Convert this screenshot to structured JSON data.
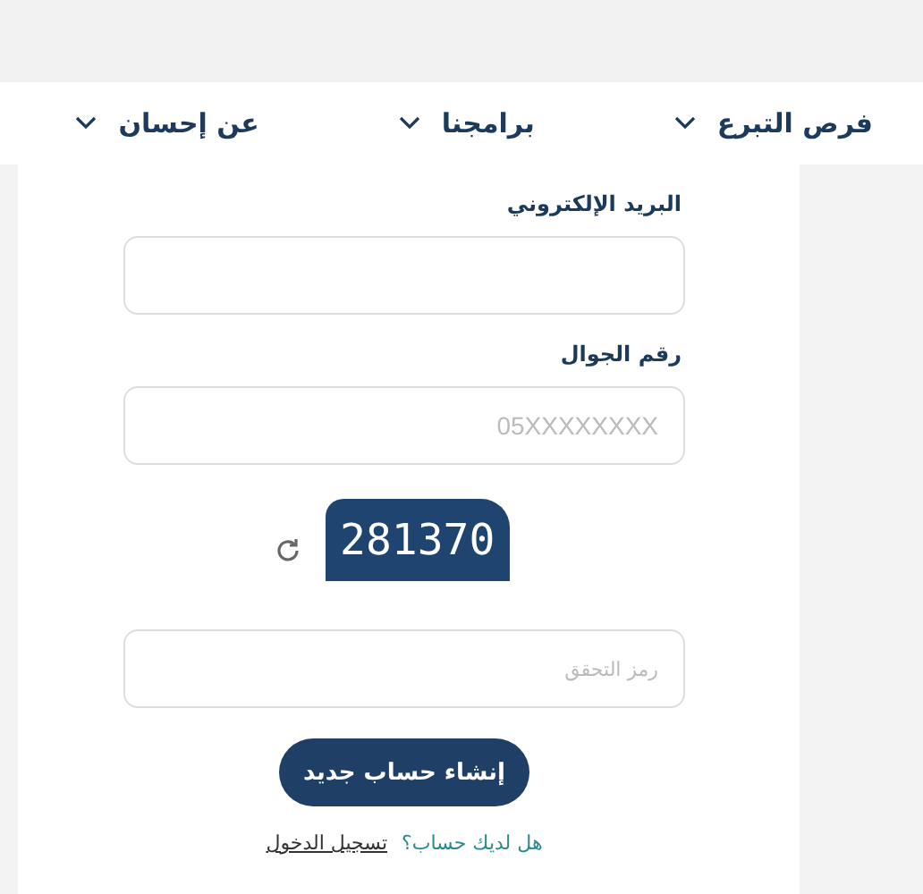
{
  "nav": {
    "items": [
      {
        "label": "فرص التبرع"
      },
      {
        "label": "برامجنا"
      },
      {
        "label": "عن إحسان"
      }
    ]
  },
  "form": {
    "fields": [
      {
        "label": "البريد الإلكتروني"
      },
      {
        "label": "رقم الجوال",
        "placeholder": "05XXXXXXXX"
      }
    ],
    "captcha": {
      "code": "281370"
    },
    "verify_field": {
      "placeholder": "رمز التحقق"
    },
    "submit": "إنشاء حساب جديد",
    "footer": {
      "question": "هل لديك حساب؟",
      "link": "تسجيل الدخول"
    }
  }
}
